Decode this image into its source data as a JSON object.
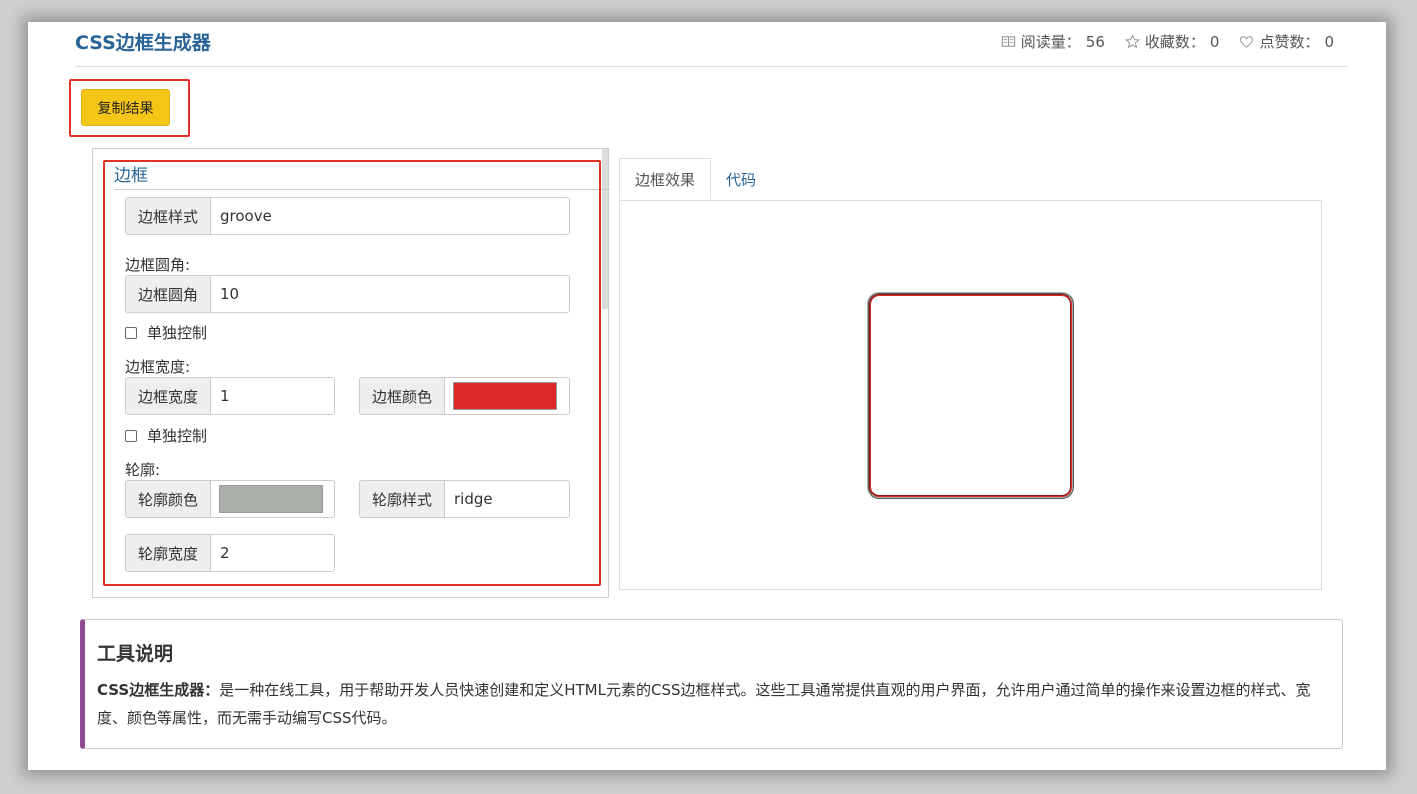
{
  "header": {
    "title": "CSS边框生成器",
    "stats": [
      {
        "icon": "read-icon",
        "label": "阅读量：",
        "value": "56"
      },
      {
        "icon": "star-icon",
        "label": "收藏数：",
        "value": "0"
      },
      {
        "icon": "heart-icon",
        "label": "点赞数：",
        "value": "0"
      }
    ]
  },
  "toolbar": {
    "copy_label": "复制结果"
  },
  "form": {
    "legend": "边框",
    "border_style": {
      "label": "边框样式",
      "value": "groove"
    },
    "radius_heading": "边框圆角:",
    "border_radius": {
      "label": "边框圆角",
      "value": "10"
    },
    "separate_control_1": "单独控制",
    "width_heading": "边框宽度:",
    "border_width": {
      "label": "边框宽度",
      "value": "1"
    },
    "border_color": {
      "label": "边框颜色",
      "value": "#dd2828"
    },
    "separate_control_2": "单独控制",
    "outline_heading": "轮廓:",
    "outline_color": {
      "label": "轮廓颜色",
      "value": "#aaaea8"
    },
    "outline_style": {
      "label": "轮廓样式",
      "value": "ridge"
    },
    "outline_width": {
      "label": "轮廓宽度",
      "value": "2"
    }
  },
  "preview": {
    "tabs": [
      {
        "label": "边框效果",
        "active": true
      },
      {
        "label": "代码",
        "active": false
      }
    ]
  },
  "info": {
    "title": "工具说明",
    "lead": "CSS边框生成器：",
    "text": "是一种在线工具，用于帮助开发人员快速创建和定义HTML元素的CSS边框样式。这些工具通常提供直观的用户界面，允许用户通过简单的操作来设置边框的样式、宽度、颜色等属性，而无需手动编写CSS代码。"
  }
}
